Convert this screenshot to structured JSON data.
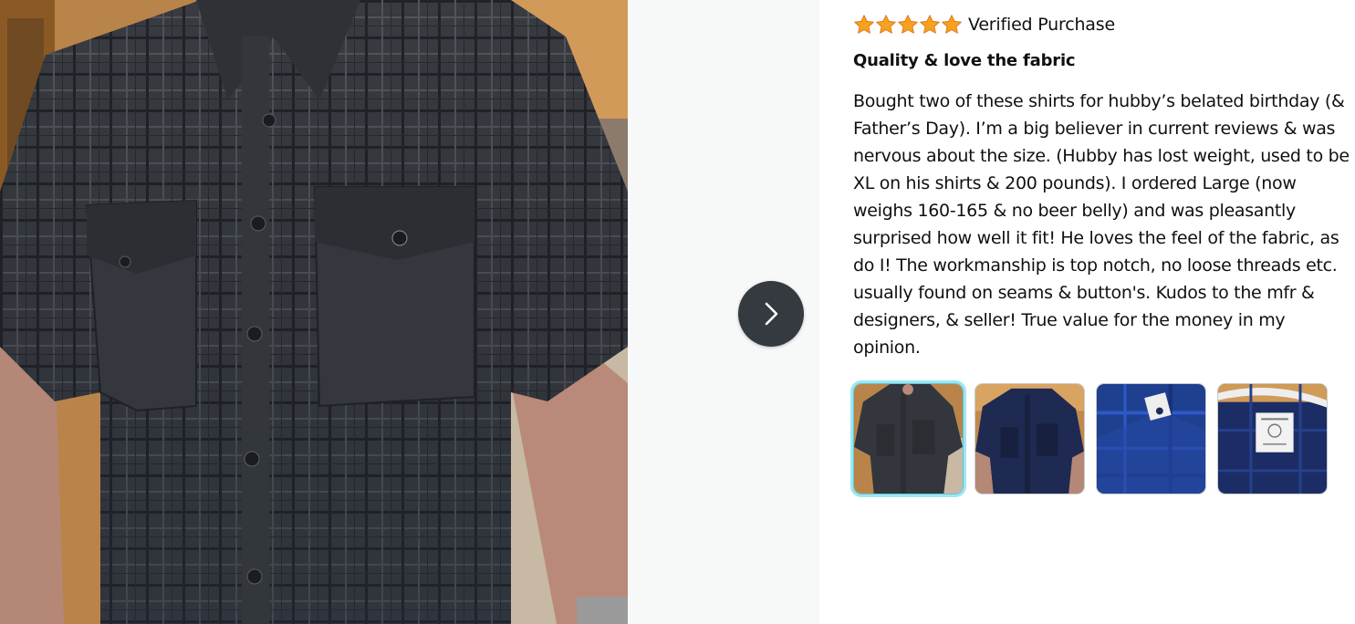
{
  "review": {
    "rating": 5,
    "rating_max": 5,
    "verified_label": "Verified Purchase",
    "title": "Quality & love the fabric",
    "body": "Bought two of these shirts for hubby’s belated birthday (& Father’s Day). I’m a big believer in current reviews & was nervous about the size. (Hubby has lost weight, used to be XL on his shirts & 200 pounds). I ordered Large (now weighs 160-165 & no beer belly) and was pleasantly surprised how well it fit! He loves the feel of the fabric, as do I! The workmanship is top notch, no loose threads etc. usually found on seams & button's. Kudos to the mfr & designers, & seller! True value for the money in my opinion."
  },
  "media": {
    "next_icon": "chevron-right-icon",
    "thumbnails": [
      {
        "name": "thumbnail-1",
        "selected": true
      },
      {
        "name": "thumbnail-2",
        "selected": false
      },
      {
        "name": "thumbnail-3",
        "selected": false
      },
      {
        "name": "thumbnail-4",
        "selected": false
      }
    ]
  },
  "colors": {
    "star": "#f7a21b",
    "next_button_bg": "#343a40",
    "selected_ring": "#9fe6f1",
    "media_bg": "#f7f8f8"
  }
}
